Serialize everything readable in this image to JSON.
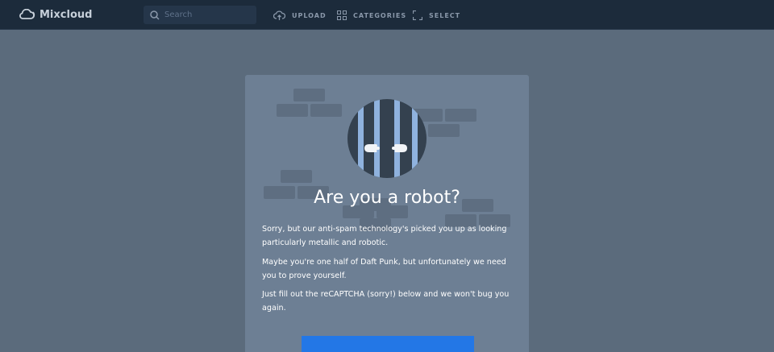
{
  "header": {
    "logo_text": "Mixcloud",
    "search_placeholder": "Search",
    "nav": [
      {
        "label": "UPLOAD",
        "icon": "cloud-upload-icon"
      },
      {
        "label": "CATEGORIES",
        "icon": "grid-icon"
      },
      {
        "label": "SELECT",
        "icon": "select-icon"
      }
    ]
  },
  "captcha": {
    "title": "Are you a robot?",
    "paragraphs": [
      "Sorry, but our anti-spam technology's picked you up as looking particularly metallic and robotic.",
      "Maybe you're one half of Daft Punk, but unfortunately we need you to prove yourself.",
      "Just fill out the reCAPTCHA (sorry!) below and we won't bug you again."
    ]
  },
  "colors": {
    "header_bg": "#1c2b3b",
    "page_bg": "#5b6b7c",
    "card_bg": "#6d7f94",
    "accent": "#2377e6"
  }
}
